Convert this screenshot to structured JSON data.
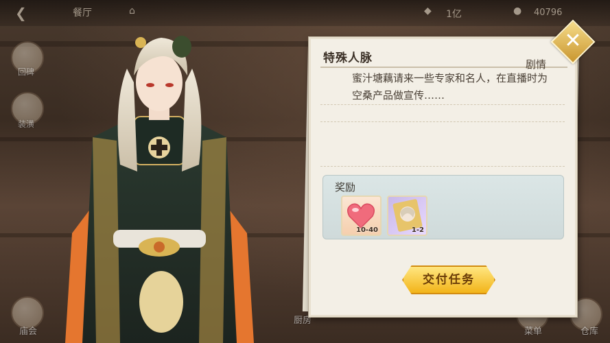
{
  "topbar": {
    "back_icon": "back-arrow-icon",
    "location": "餐厅",
    "currency_small": "1亿",
    "coins": "40796"
  },
  "side_menu_left": [
    "回碑",
    "装潢"
  ],
  "bottom_labels": {
    "left": "庙会",
    "center": "厨房",
    "right_1": "菜单",
    "right_2": "仓库"
  },
  "quest_panel": {
    "title": "特殊人脉",
    "tag": "剧情",
    "description": "蜜汁塘藕请来一些专家和名人，在直播时为空桑产品做宣传……",
    "reward_label": "奖励",
    "rewards": [
      {
        "name": "heart-item",
        "qty": "10-40"
      },
      {
        "name": "portrait-card-item",
        "qty": "1-2"
      }
    ],
    "submit_label": "交付任务",
    "close_icon": "close-icon"
  }
}
